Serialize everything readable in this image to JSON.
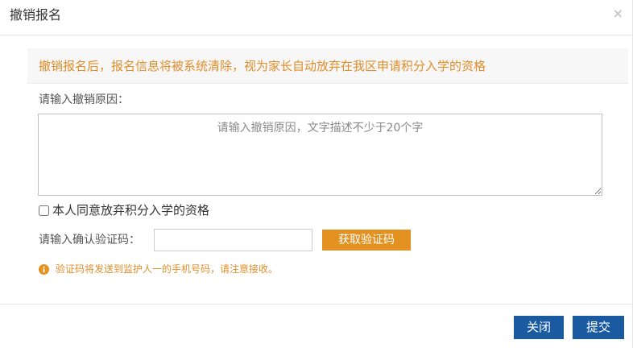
{
  "dialog": {
    "title": "撤销报名",
    "close_glyph": "×"
  },
  "notice": {
    "text": "撤销报名后，报名信息将被系统清除，视为家长自动放弃在我区申请积分入学的资格",
    "color": "#e08e2b"
  },
  "reason": {
    "label": "请输入撤销原因：",
    "placeholder": "请输入撤销原因，文字描述不少于20个字",
    "value": ""
  },
  "agree": {
    "label": "本人同意放弃积分入学的资格",
    "checked": false
  },
  "verify": {
    "label": "请输入确认验证码：",
    "value": "",
    "get_code_label": "获取验证码",
    "button_color": "#e39222"
  },
  "hint": {
    "icon": "info-circle-icon",
    "text": "验证码将发送到监护人一的手机号码，请注意接收。"
  },
  "footer": {
    "close_label": "关闭",
    "submit_label": "提交",
    "button_color": "#1a5aa0"
  }
}
